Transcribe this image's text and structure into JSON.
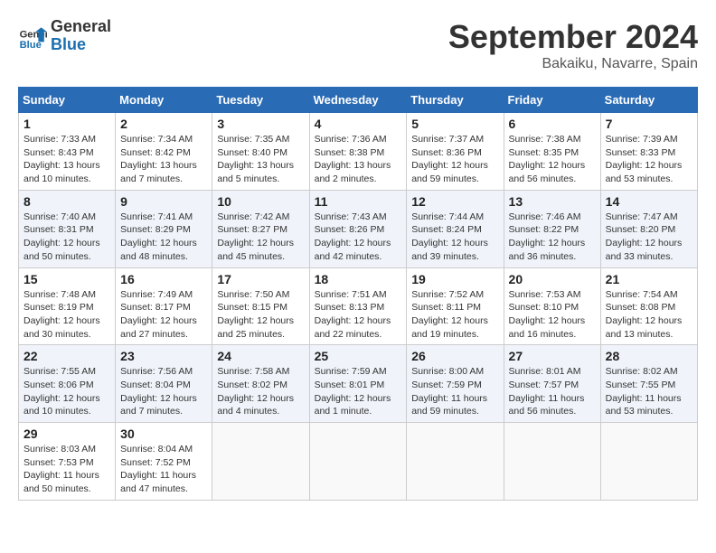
{
  "header": {
    "logo_line1": "General",
    "logo_line2": "Blue",
    "month": "September 2024",
    "location": "Bakaiku, Navarre, Spain"
  },
  "weekdays": [
    "Sunday",
    "Monday",
    "Tuesday",
    "Wednesday",
    "Thursday",
    "Friday",
    "Saturday"
  ],
  "weeks": [
    [
      {
        "day": "1",
        "sunrise": "Sunrise: 7:33 AM",
        "sunset": "Sunset: 8:43 PM",
        "daylight": "Daylight: 13 hours and 10 minutes."
      },
      {
        "day": "2",
        "sunrise": "Sunrise: 7:34 AM",
        "sunset": "Sunset: 8:42 PM",
        "daylight": "Daylight: 13 hours and 7 minutes."
      },
      {
        "day": "3",
        "sunrise": "Sunrise: 7:35 AM",
        "sunset": "Sunset: 8:40 PM",
        "daylight": "Daylight: 13 hours and 5 minutes."
      },
      {
        "day": "4",
        "sunrise": "Sunrise: 7:36 AM",
        "sunset": "Sunset: 8:38 PM",
        "daylight": "Daylight: 13 hours and 2 minutes."
      },
      {
        "day": "5",
        "sunrise": "Sunrise: 7:37 AM",
        "sunset": "Sunset: 8:36 PM",
        "daylight": "Daylight: 12 hours and 59 minutes."
      },
      {
        "day": "6",
        "sunrise": "Sunrise: 7:38 AM",
        "sunset": "Sunset: 8:35 PM",
        "daylight": "Daylight: 12 hours and 56 minutes."
      },
      {
        "day": "7",
        "sunrise": "Sunrise: 7:39 AM",
        "sunset": "Sunset: 8:33 PM",
        "daylight": "Daylight: 12 hours and 53 minutes."
      }
    ],
    [
      {
        "day": "8",
        "sunrise": "Sunrise: 7:40 AM",
        "sunset": "Sunset: 8:31 PM",
        "daylight": "Daylight: 12 hours and 50 minutes."
      },
      {
        "day": "9",
        "sunrise": "Sunrise: 7:41 AM",
        "sunset": "Sunset: 8:29 PM",
        "daylight": "Daylight: 12 hours and 48 minutes."
      },
      {
        "day": "10",
        "sunrise": "Sunrise: 7:42 AM",
        "sunset": "Sunset: 8:27 PM",
        "daylight": "Daylight: 12 hours and 45 minutes."
      },
      {
        "day": "11",
        "sunrise": "Sunrise: 7:43 AM",
        "sunset": "Sunset: 8:26 PM",
        "daylight": "Daylight: 12 hours and 42 minutes."
      },
      {
        "day": "12",
        "sunrise": "Sunrise: 7:44 AM",
        "sunset": "Sunset: 8:24 PM",
        "daylight": "Daylight: 12 hours and 39 minutes."
      },
      {
        "day": "13",
        "sunrise": "Sunrise: 7:46 AM",
        "sunset": "Sunset: 8:22 PM",
        "daylight": "Daylight: 12 hours and 36 minutes."
      },
      {
        "day": "14",
        "sunrise": "Sunrise: 7:47 AM",
        "sunset": "Sunset: 8:20 PM",
        "daylight": "Daylight: 12 hours and 33 minutes."
      }
    ],
    [
      {
        "day": "15",
        "sunrise": "Sunrise: 7:48 AM",
        "sunset": "Sunset: 8:19 PM",
        "daylight": "Daylight: 12 hours and 30 minutes."
      },
      {
        "day": "16",
        "sunrise": "Sunrise: 7:49 AM",
        "sunset": "Sunset: 8:17 PM",
        "daylight": "Daylight: 12 hours and 27 minutes."
      },
      {
        "day": "17",
        "sunrise": "Sunrise: 7:50 AM",
        "sunset": "Sunset: 8:15 PM",
        "daylight": "Daylight: 12 hours and 25 minutes."
      },
      {
        "day": "18",
        "sunrise": "Sunrise: 7:51 AM",
        "sunset": "Sunset: 8:13 PM",
        "daylight": "Daylight: 12 hours and 22 minutes."
      },
      {
        "day": "19",
        "sunrise": "Sunrise: 7:52 AM",
        "sunset": "Sunset: 8:11 PM",
        "daylight": "Daylight: 12 hours and 19 minutes."
      },
      {
        "day": "20",
        "sunrise": "Sunrise: 7:53 AM",
        "sunset": "Sunset: 8:10 PM",
        "daylight": "Daylight: 12 hours and 16 minutes."
      },
      {
        "day": "21",
        "sunrise": "Sunrise: 7:54 AM",
        "sunset": "Sunset: 8:08 PM",
        "daylight": "Daylight: 12 hours and 13 minutes."
      }
    ],
    [
      {
        "day": "22",
        "sunrise": "Sunrise: 7:55 AM",
        "sunset": "Sunset: 8:06 PM",
        "daylight": "Daylight: 12 hours and 10 minutes."
      },
      {
        "day": "23",
        "sunrise": "Sunrise: 7:56 AM",
        "sunset": "Sunset: 8:04 PM",
        "daylight": "Daylight: 12 hours and 7 minutes."
      },
      {
        "day": "24",
        "sunrise": "Sunrise: 7:58 AM",
        "sunset": "Sunset: 8:02 PM",
        "daylight": "Daylight: 12 hours and 4 minutes."
      },
      {
        "day": "25",
        "sunrise": "Sunrise: 7:59 AM",
        "sunset": "Sunset: 8:01 PM",
        "daylight": "Daylight: 12 hours and 1 minute."
      },
      {
        "day": "26",
        "sunrise": "Sunrise: 8:00 AM",
        "sunset": "Sunset: 7:59 PM",
        "daylight": "Daylight: 11 hours and 59 minutes."
      },
      {
        "day": "27",
        "sunrise": "Sunrise: 8:01 AM",
        "sunset": "Sunset: 7:57 PM",
        "daylight": "Daylight: 11 hours and 56 minutes."
      },
      {
        "day": "28",
        "sunrise": "Sunrise: 8:02 AM",
        "sunset": "Sunset: 7:55 PM",
        "daylight": "Daylight: 11 hours and 53 minutes."
      }
    ],
    [
      {
        "day": "29",
        "sunrise": "Sunrise: 8:03 AM",
        "sunset": "Sunset: 7:53 PM",
        "daylight": "Daylight: 11 hours and 50 minutes."
      },
      {
        "day": "30",
        "sunrise": "Sunrise: 8:04 AM",
        "sunset": "Sunset: 7:52 PM",
        "daylight": "Daylight: 11 hours and 47 minutes."
      },
      null,
      null,
      null,
      null,
      null
    ]
  ]
}
